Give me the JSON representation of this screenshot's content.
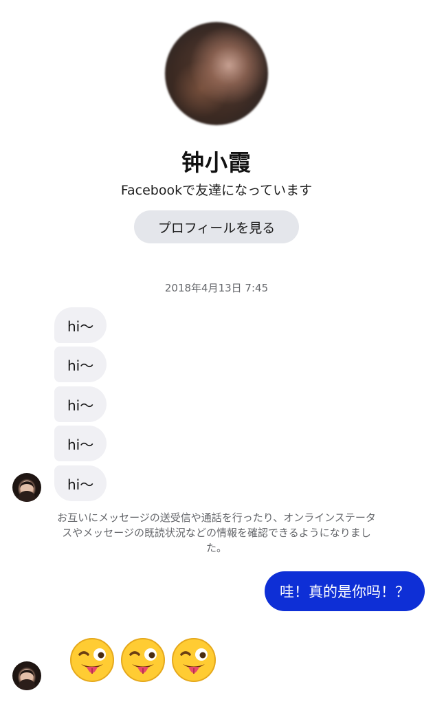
{
  "contact": {
    "name": "钟小霞",
    "subtitle": "Facebookで友達になっています",
    "profile_button": "プロフィールを見る"
  },
  "conversation": {
    "timestamp": "2018年4月13日 7:45",
    "received_messages": [
      "hi〜",
      "hi〜",
      "hi〜",
      "hi〜",
      "hi〜"
    ],
    "system_note": "お互いにメッセージの送受信や通話を行ったり、オンラインステータスやメッセージの既読状況などの情報を確認できるようになりました。",
    "sent_message": "哇！真的是你吗！？",
    "sent_color": "#0e2fd6",
    "emoji_reply": [
      "winking-face-with-tongue",
      "winking-face-with-tongue",
      "winking-face-with-tongue"
    ]
  }
}
